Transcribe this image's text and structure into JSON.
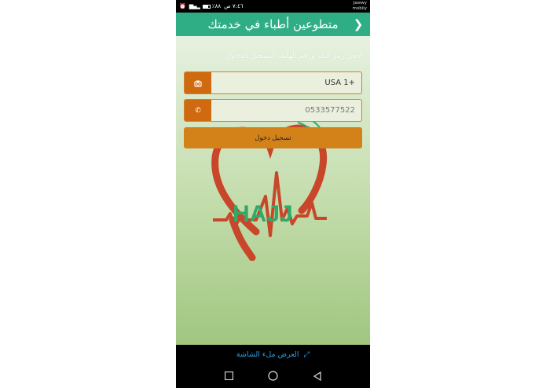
{
  "status_bar": {
    "time": "٧:٤٦ ص",
    "battery": "٨٨٪",
    "carrier_line1": "Jawwy",
    "carrier_line2": "mobily"
  },
  "header": {
    "title": "متطوعين أطباء في خدمتك",
    "back_icon": "chevron-right-icon"
  },
  "form": {
    "prompt": "أدخل رمز البلد ورقم الهاتف لتسجيل الدخول",
    "country_code": {
      "value": "USA 1+",
      "icon": "globe-icon"
    },
    "phone": {
      "value": "0533577522",
      "icon": "phone-icon"
    },
    "login_label": "تسجيل دخول"
  },
  "logo": {
    "text": "HAJJ",
    "heart_color": "#c8472a",
    "text_color": "#2faa6a"
  },
  "fullscreen_bar": {
    "label": "العرض ملء الشاشة",
    "icon": "fullscreen-icon"
  },
  "colors": {
    "appbar": "#2fae86",
    "accent": "#d06a10",
    "button": "#d3821a",
    "link": "#2aa0e8"
  }
}
